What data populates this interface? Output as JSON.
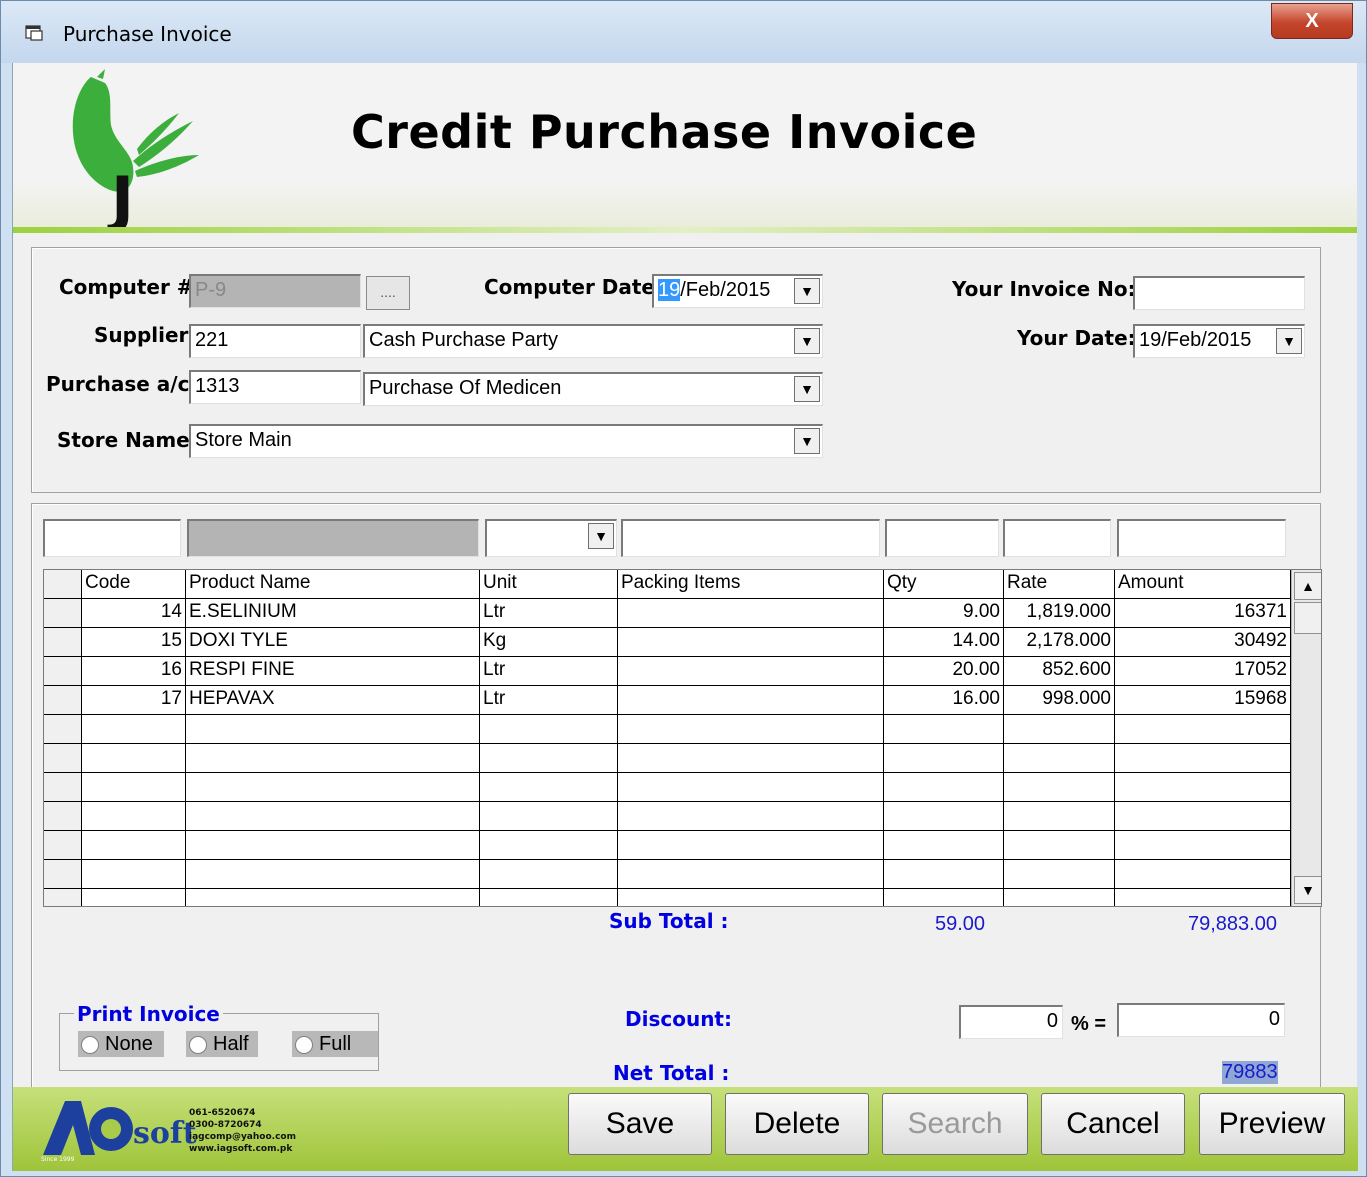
{
  "window": {
    "title": "Purchase Invoice",
    "close_label": "X"
  },
  "header": {
    "title": "Credit Purchase Invoice",
    "logo_text": "J"
  },
  "form": {
    "computer_no_label": "Computer #:",
    "computer_no_value": "P-9",
    "browse_label": "....",
    "computer_date_label": "Computer Date:",
    "computer_date_day": "19",
    "computer_date_rest": "/Feb/2015",
    "your_invoice_label": "Your Invoice No:",
    "your_invoice_value": "",
    "supplier_label": "Supplier:",
    "supplier_code": "221",
    "supplier_name": "Cash Purchase Party",
    "your_date_label": "Your Date:",
    "your_date_value": "19/Feb/2015",
    "purchase_label": "Purchase a/c",
    "purchase_code": "1313",
    "purchase_name": "Purchase Of Medicen",
    "store_label": "Store Name:",
    "store_value": "Store Main"
  },
  "grid": {
    "columns": [
      "Code",
      "Product Name",
      "Unit",
      "Packing Items",
      "Qty",
      "Rate",
      "Amount"
    ],
    "rows": [
      {
        "code": "14",
        "product": "E.SELINIUM",
        "unit": "Ltr",
        "packing": "",
        "qty": "9.00",
        "rate": "1,819.000",
        "amount": "16371"
      },
      {
        "code": "15",
        "product": "DOXI TYLE",
        "unit": "Kg",
        "packing": "",
        "qty": "14.00",
        "rate": "2,178.000",
        "amount": "30492"
      },
      {
        "code": "16",
        "product": "RESPI FINE",
        "unit": "Ltr",
        "packing": "",
        "qty": "20.00",
        "rate": "852.600",
        "amount": "17052"
      },
      {
        "code": "17",
        "product": "HEPAVAX",
        "unit": "Ltr",
        "packing": "",
        "qty": "16.00",
        "rate": "998.000",
        "amount": "15968"
      }
    ]
  },
  "totals": {
    "subtotal_label": "Sub Total :",
    "subtotal_qty": "59.00",
    "subtotal_amount": "79,883.00",
    "discount_label": "Discount:",
    "discount_percent": "0",
    "percent_sign": "% =",
    "discount_amount": "0",
    "net_total_label": "Net Total :",
    "net_total_value": "79883"
  },
  "print_invoice": {
    "label": "Print Invoice",
    "options": [
      "None",
      "Half",
      "Full"
    ]
  },
  "footer": {
    "brand": "soft",
    "brand_prefix": "IAG",
    "since": "Since 1999",
    "phone1": "061-6520674",
    "phone2": "0300-8720674",
    "email": "iagcomp@yahoo.com",
    "website": "www.iagsoft.com.pk",
    "buttons": {
      "save": "Save",
      "delete": "Delete",
      "search": "Search",
      "cancel": "Cancel",
      "preview": "Preview"
    }
  },
  "colors": {
    "accent_blue": "#0000e0",
    "footer_green": "#9fc43a",
    "header_green": "#9cd13e"
  }
}
